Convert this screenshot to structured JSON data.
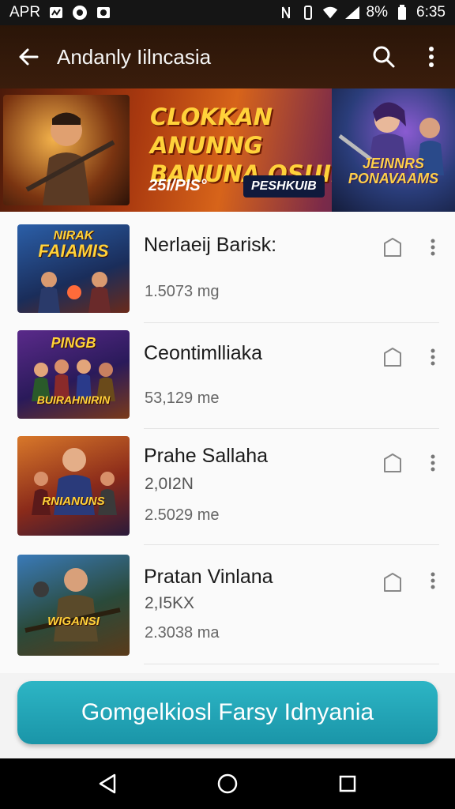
{
  "status_bar": {
    "carrier": "APR",
    "battery": "8%",
    "time": "6:35",
    "icons": [
      "notification-icon",
      "app-icon",
      "image-icon",
      "nfc-icon",
      "vibrate-icon",
      "wifi-icon",
      "signal-icon",
      "battery-icon"
    ]
  },
  "app_bar": {
    "title": "Andanly Iilncasia",
    "back_icon": "arrow-back-icon",
    "search_icon": "search-icon",
    "more_icon": "more-vert-icon"
  },
  "banner": {
    "headline_line1": "CLOKKAN ANUNNG",
    "headline_line2": "BANUNA OSUII",
    "price": "25I/PIS°",
    "chip": "PESHKUIB",
    "logo_line1": "JEINNRS",
    "logo_line2": "PONAVAAMS"
  },
  "items": [
    {
      "title": "Nerlaeij Barisk:",
      "subtitle": "",
      "meta": "1.5073 mg",
      "thumb_text_line1": "NIRAK",
      "thumb_text_line2": "FAIAMIS"
    },
    {
      "title": "Ceontimlliaka",
      "subtitle": "",
      "meta": "53,129 me",
      "thumb_text_line1": "PINGB",
      "thumb_text_line2": "BUIRAHNIRIN"
    },
    {
      "title": "Prahe Sallaha",
      "subtitle": "2,0I2N",
      "meta": "2.5029 me",
      "thumb_text_line1": "RNIANUNS",
      "thumb_text_line2": ""
    },
    {
      "title": "Pratan Vinlana",
      "subtitle": "2,I5KX",
      "meta": "2.3038 ma",
      "thumb_text_line1": "WIGANSI",
      "thumb_text_line2": ""
    }
  ],
  "cta": {
    "label": "Gomgelkiosl Farsy Idnyania"
  },
  "nav_bar": {
    "icons": [
      "back-triangle-icon",
      "home-circle-icon",
      "recents-square-icon"
    ]
  },
  "colors": {
    "app_bar": "#2a1508",
    "cta": "#1fa6b8",
    "status_bar": "#151515"
  }
}
